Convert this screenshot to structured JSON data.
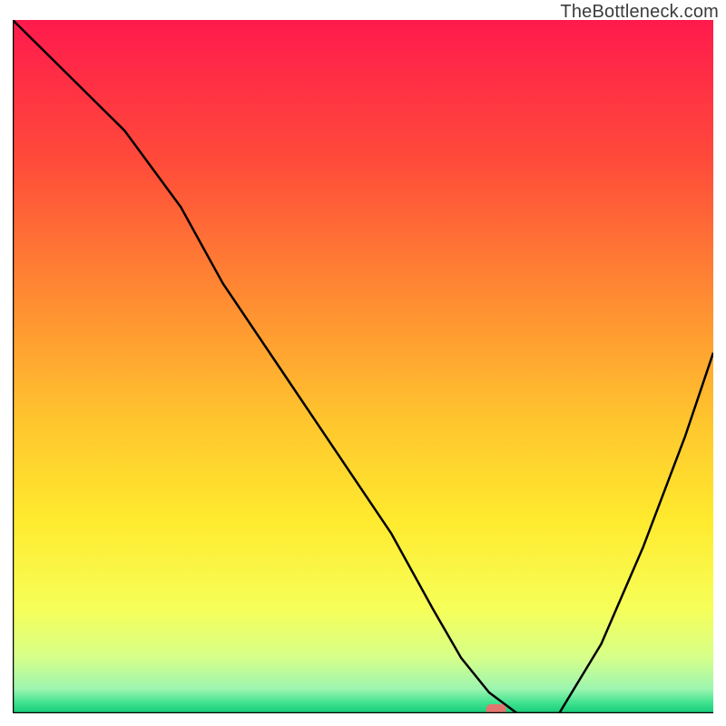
{
  "attribution": "TheBottleneck.com",
  "chart_data": {
    "type": "line",
    "title": "",
    "xlabel": "",
    "ylabel": "",
    "xlim": [
      0,
      100
    ],
    "ylim": [
      0,
      100
    ],
    "grid": false,
    "legend": false,
    "background": {
      "type": "vertical-gradient",
      "stops": [
        {
          "offset": 0.0,
          "color": "#ff1a4d"
        },
        {
          "offset": 0.2,
          "color": "#ff4a3a"
        },
        {
          "offset": 0.4,
          "color": "#ff8b32"
        },
        {
          "offset": 0.58,
          "color": "#ffc62e"
        },
        {
          "offset": 0.72,
          "color": "#ffea2e"
        },
        {
          "offset": 0.85,
          "color": "#f6ff59"
        },
        {
          "offset": 0.92,
          "color": "#d6ff8a"
        },
        {
          "offset": 0.965,
          "color": "#9cf5b0"
        },
        {
          "offset": 0.985,
          "color": "#3fe28f"
        },
        {
          "offset": 1.0,
          "color": "#14cc78"
        }
      ]
    },
    "series": [
      {
        "name": "bottleneck-curve",
        "x": [
          0,
          8,
          16,
          24,
          30,
          38,
          46,
          54,
          60,
          64,
          68,
          72,
          78,
          84,
          90,
          96,
          100
        ],
        "y": [
          100,
          92,
          84,
          73,
          62,
          50,
          38,
          26,
          15,
          8,
          3,
          0,
          0,
          10,
          24,
          40,
          52
        ]
      }
    ],
    "marker": {
      "name": "optimal-point",
      "x": 69,
      "y": 0,
      "shape": "rounded-rect",
      "color": "#e2766f"
    }
  }
}
